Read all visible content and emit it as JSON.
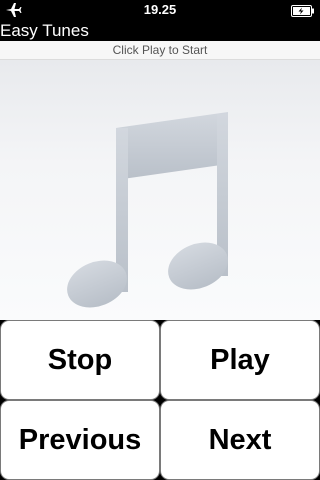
{
  "status_bar": {
    "time": "19.25",
    "left_icon": "airplane-icon",
    "right_icon": "battery-charging-icon"
  },
  "app": {
    "title": "Easy Tunes"
  },
  "subtitle": "Click Play to Start",
  "artwork_icon": "music-note-icon",
  "controls": {
    "stop_label": "Stop",
    "play_label": "Play",
    "previous_label": "Previous",
    "next_label": "Next"
  },
  "colors": {
    "note": "#c6ccd4",
    "button_border": "#7a7a7a",
    "background": "#000000"
  }
}
